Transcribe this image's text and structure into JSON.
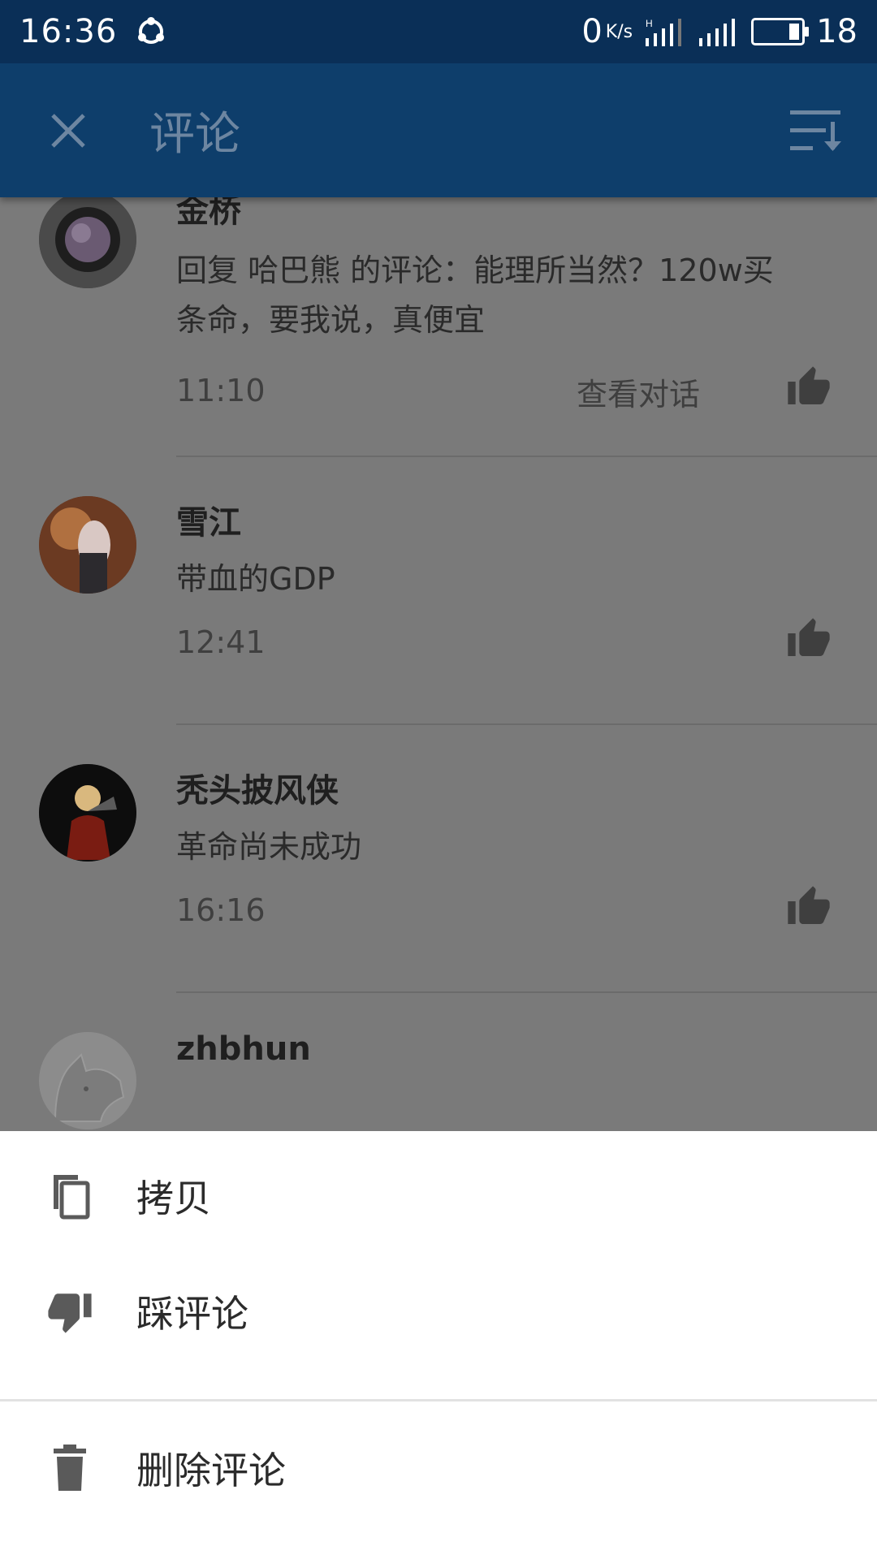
{
  "status_bar": {
    "time": "16:36",
    "net_speed_value": "0",
    "net_speed_unit": "K/s",
    "battery_level": "18",
    "icons": [
      "sync-icon",
      "signal-h-icon",
      "signal-icon",
      "battery-icon"
    ]
  },
  "app_bar": {
    "title": "评论",
    "close_icon": "close-icon",
    "sort_icon": "sort-icon"
  },
  "comments": [
    {
      "author": "金桥",
      "content_line1": "回复 哈巴熊 的评论：能理所当然？120w买",
      "content_line2": "条命，要我说，真便宜",
      "time": "11:10",
      "view_dialog": "查看对话"
    },
    {
      "author": "雪江",
      "content": "带血的GDP",
      "time": "12:41"
    },
    {
      "author": "秃头披风侠",
      "content": "革命尚未成功",
      "time": "16:16"
    },
    {
      "author": "zhbhun"
    }
  ],
  "sheet": {
    "items": [
      {
        "label": "拷贝",
        "icon": "copy-icon"
      },
      {
        "label": "踩评论",
        "icon": "thumb-down-icon"
      },
      {
        "label": "删除评论",
        "icon": "trash-icon"
      }
    ]
  },
  "colors": {
    "status_bar": "#0a2f57",
    "app_bar": "#0e3e6b",
    "scrim_list": "#7a7a7a",
    "sheet": "#ffffff"
  }
}
